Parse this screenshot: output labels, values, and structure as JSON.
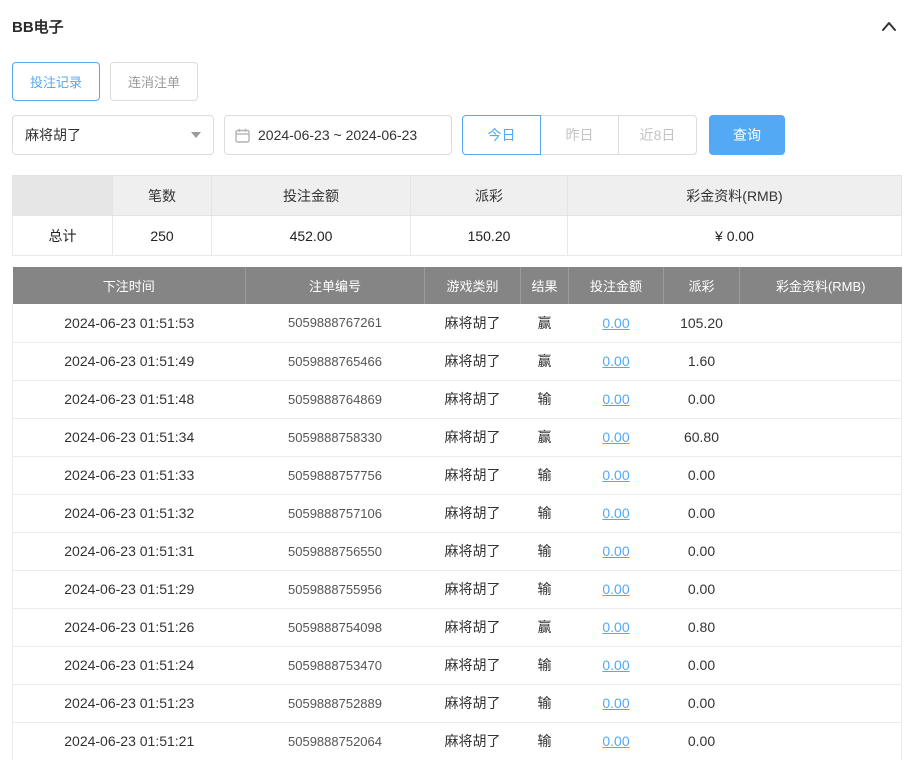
{
  "header": {
    "title": "BB电子"
  },
  "tabs": [
    {
      "label": "投注记录",
      "active": true
    },
    {
      "label": "连消注单",
      "active": false
    }
  ],
  "filters": {
    "game_select": "麻将胡了",
    "date_range": "2024-06-23 ~ 2024-06-23",
    "quick_buttons": [
      {
        "label": "今日",
        "active": true
      },
      {
        "label": "昨日",
        "active": false
      },
      {
        "label": "近8日",
        "active": false
      }
    ],
    "search_label": "查询"
  },
  "summary": {
    "headers": [
      "",
      "笔数",
      "投注金额",
      "派彩",
      "彩金资料(RMB)"
    ],
    "row_label": "总计",
    "count": "250",
    "bet_amount": "452.00",
    "payout": "150.20",
    "bonus": "¥ 0.00"
  },
  "table": {
    "headers": [
      "下注时间",
      "注单编号",
      "游戏类别",
      "结果",
      "投注金额",
      "派彩",
      "彩金资料(RMB)"
    ],
    "rows": [
      {
        "time": "2024-06-23 01:51:53",
        "order_id": "5059888767261",
        "game": "麻将胡了",
        "result": "赢",
        "bet": "0.00",
        "payout": "105.20",
        "bonus": ""
      },
      {
        "time": "2024-06-23 01:51:49",
        "order_id": "5059888765466",
        "game": "麻将胡了",
        "result": "赢",
        "bet": "0.00",
        "payout": "1.60",
        "bonus": ""
      },
      {
        "time": "2024-06-23 01:51:48",
        "order_id": "5059888764869",
        "game": "麻将胡了",
        "result": "输",
        "bet": "0.00",
        "payout": "0.00",
        "bonus": ""
      },
      {
        "time": "2024-06-23 01:51:34",
        "order_id": "5059888758330",
        "game": "麻将胡了",
        "result": "赢",
        "bet": "0.00",
        "payout": "60.80",
        "bonus": ""
      },
      {
        "time": "2024-06-23 01:51:33",
        "order_id": "5059888757756",
        "game": "麻将胡了",
        "result": "输",
        "bet": "0.00",
        "payout": "0.00",
        "bonus": ""
      },
      {
        "time": "2024-06-23 01:51:32",
        "order_id": "5059888757106",
        "game": "麻将胡了",
        "result": "输",
        "bet": "0.00",
        "payout": "0.00",
        "bonus": ""
      },
      {
        "time": "2024-06-23 01:51:31",
        "order_id": "5059888756550",
        "game": "麻将胡了",
        "result": "输",
        "bet": "0.00",
        "payout": "0.00",
        "bonus": ""
      },
      {
        "time": "2024-06-23 01:51:29",
        "order_id": "5059888755956",
        "game": "麻将胡了",
        "result": "输",
        "bet": "0.00",
        "payout": "0.00",
        "bonus": ""
      },
      {
        "time": "2024-06-23 01:51:26",
        "order_id": "5059888754098",
        "game": "麻将胡了",
        "result": "赢",
        "bet": "0.00",
        "payout": "0.80",
        "bonus": ""
      },
      {
        "time": "2024-06-23 01:51:24",
        "order_id": "5059888753470",
        "game": "麻将胡了",
        "result": "输",
        "bet": "0.00",
        "payout": "0.00",
        "bonus": ""
      },
      {
        "time": "2024-06-23 01:51:23",
        "order_id": "5059888752889",
        "game": "麻将胡了",
        "result": "输",
        "bet": "0.00",
        "payout": "0.00",
        "bonus": ""
      },
      {
        "time": "2024-06-23 01:51:21",
        "order_id": "5059888752064",
        "game": "麻将胡了",
        "result": "输",
        "bet": "0.00",
        "payout": "0.00",
        "bonus": ""
      }
    ]
  },
  "colors": {
    "accent": "#54a9f4",
    "table_header_bg": "#858585"
  }
}
